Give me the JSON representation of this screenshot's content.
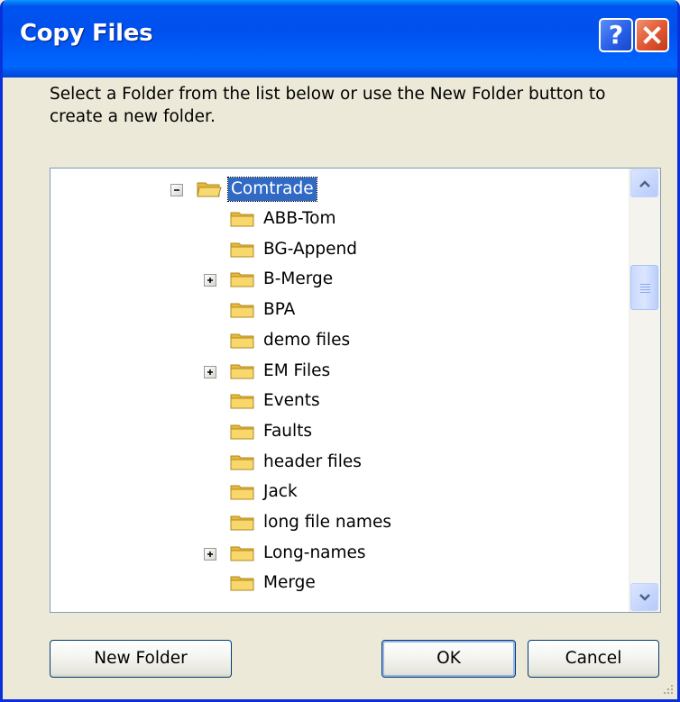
{
  "window": {
    "title": "Copy Files",
    "help_label": "?",
    "close_label": "✕"
  },
  "instructions": "Select a Folder from the list below or use the New Folder button to create a new folder.",
  "tree": {
    "root": {
      "label": "Comtrade",
      "expanded": true,
      "selected": true
    },
    "children": [
      {
        "label": "ABB-Tom",
        "has_children": false
      },
      {
        "label": "BG-Append",
        "has_children": false
      },
      {
        "label": "B-Merge",
        "has_children": true
      },
      {
        "label": "BPA",
        "has_children": false
      },
      {
        "label": "demo files",
        "has_children": false
      },
      {
        "label": "EM Files",
        "has_children": true
      },
      {
        "label": "Events",
        "has_children": false
      },
      {
        "label": "Faults",
        "has_children": false
      },
      {
        "label": "header files",
        "has_children": false
      },
      {
        "label": "Jack",
        "has_children": false
      },
      {
        "label": "long file names",
        "has_children": false
      },
      {
        "label": "Long-names",
        "has_children": true
      },
      {
        "label": "Merge",
        "has_children": false
      }
    ]
  },
  "buttons": {
    "new_folder": "New Folder",
    "ok": "OK",
    "cancel": "Cancel"
  },
  "colors": {
    "titlebar": "#0055ea",
    "selection": "#316ac5",
    "folder": "#f5d36b",
    "dialog_bg": "#ece9d8"
  },
  "icons": {
    "folder": "folder-icon",
    "expand": "plus-icon",
    "collapse": "minus-icon"
  }
}
